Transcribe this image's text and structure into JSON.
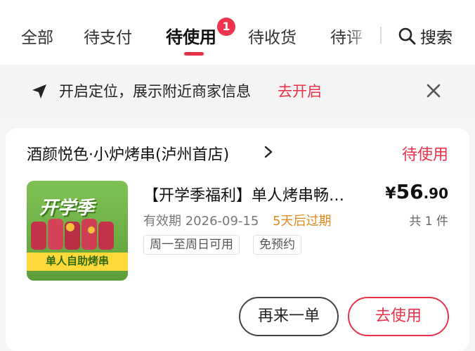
{
  "tabs": {
    "items": [
      {
        "label": "全部"
      },
      {
        "label": "待支付"
      },
      {
        "label": "待使用"
      },
      {
        "label": "待收货"
      },
      {
        "label": "待评"
      }
    ],
    "active_badge": "1",
    "search_label": "搜索"
  },
  "banner": {
    "text": "开启定位，展示附近商家信息",
    "action": "去开启"
  },
  "order": {
    "shop_name": "酒颜悦色·小炉烤串(泸州首店)",
    "status": "待使用",
    "thumb_title": "开学季",
    "thumb_caption": "单人自助烤串",
    "product_title": "【开学季福利】单人烤串畅…",
    "price_symbol": "¥",
    "price_int": "56",
    "price_dec": ".90",
    "expire": "有效期 2026-09-15",
    "expire_warn": "5天后过期",
    "quantity": "共 1 件",
    "tags": [
      "周一至周日可用",
      "免预约"
    ],
    "btn_again": "再来一单",
    "btn_use": "去使用"
  },
  "colors": {
    "accent": "#e8324a",
    "warn": "#e08a1e"
  }
}
